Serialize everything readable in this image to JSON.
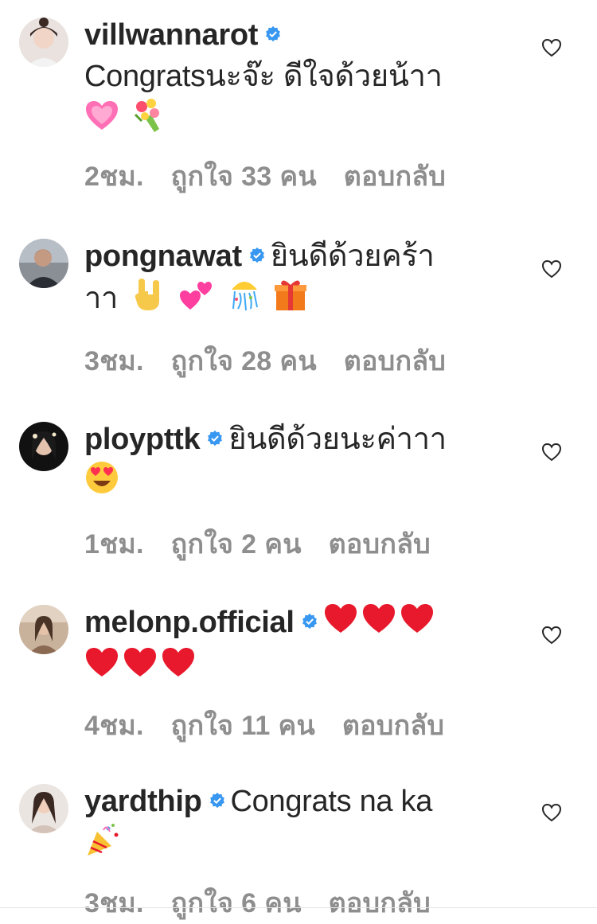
{
  "comments": [
    {
      "username": "villwannarot",
      "text": "Congratsนะจ๊ะ ดีใจด้วยน้าา",
      "emojis": [
        "pink-heart",
        "bouquet"
      ],
      "time": "2ชม.",
      "likes_prefix": "ถูกใจ",
      "likes_count": "33",
      "likes_suffix": "คน",
      "reply": "ตอบกลับ",
      "avatar_color": "#d9c3b8"
    },
    {
      "username": "pongnawat",
      "text": "ยินดีด้วยคร้า",
      "text2": "าา",
      "emojis": [
        "rock-hand",
        "two-hearts",
        "confetti-ball",
        "gift"
      ],
      "time": "3ชม.",
      "likes_prefix": "ถูกใจ",
      "likes_count": "28",
      "likes_suffix": "คน",
      "reply": "ตอบกลับ",
      "avatar_color": "#5a5e66"
    },
    {
      "username": "ploypttk",
      "text": "ยินดีด้วยนะค่าาา",
      "emojis": [
        "heart-eyes"
      ],
      "time": "1ชม.",
      "likes_prefix": "ถูกใจ",
      "likes_count": "2",
      "likes_suffix": "คน",
      "reply": "ตอบกลับ",
      "avatar_color": "#2b2b2b"
    },
    {
      "username": "melonp.official",
      "text": "",
      "emojis": [
        "red-heart",
        "red-heart",
        "red-heart",
        "red-heart",
        "red-heart",
        "red-heart"
      ],
      "time": "4ชม.",
      "likes_prefix": "ถูกใจ",
      "likes_count": "11",
      "likes_suffix": "คน",
      "reply": "ตอบกลับ",
      "avatar_color": "#a88a74"
    },
    {
      "username": "yardthip",
      "text": "Congrats na ka",
      "emojis": [
        "party-popper"
      ],
      "time": "3ชม.",
      "likes_prefix": "ถูกใจ",
      "likes_count": "6",
      "likes_suffix": "คน",
      "reply": "ตอบกลับ",
      "avatar_color": "#c9b7ae"
    }
  ],
  "colors": {
    "verified": "#3897f0",
    "meta_text": "#8e8e8e",
    "primary_text": "#262626"
  }
}
